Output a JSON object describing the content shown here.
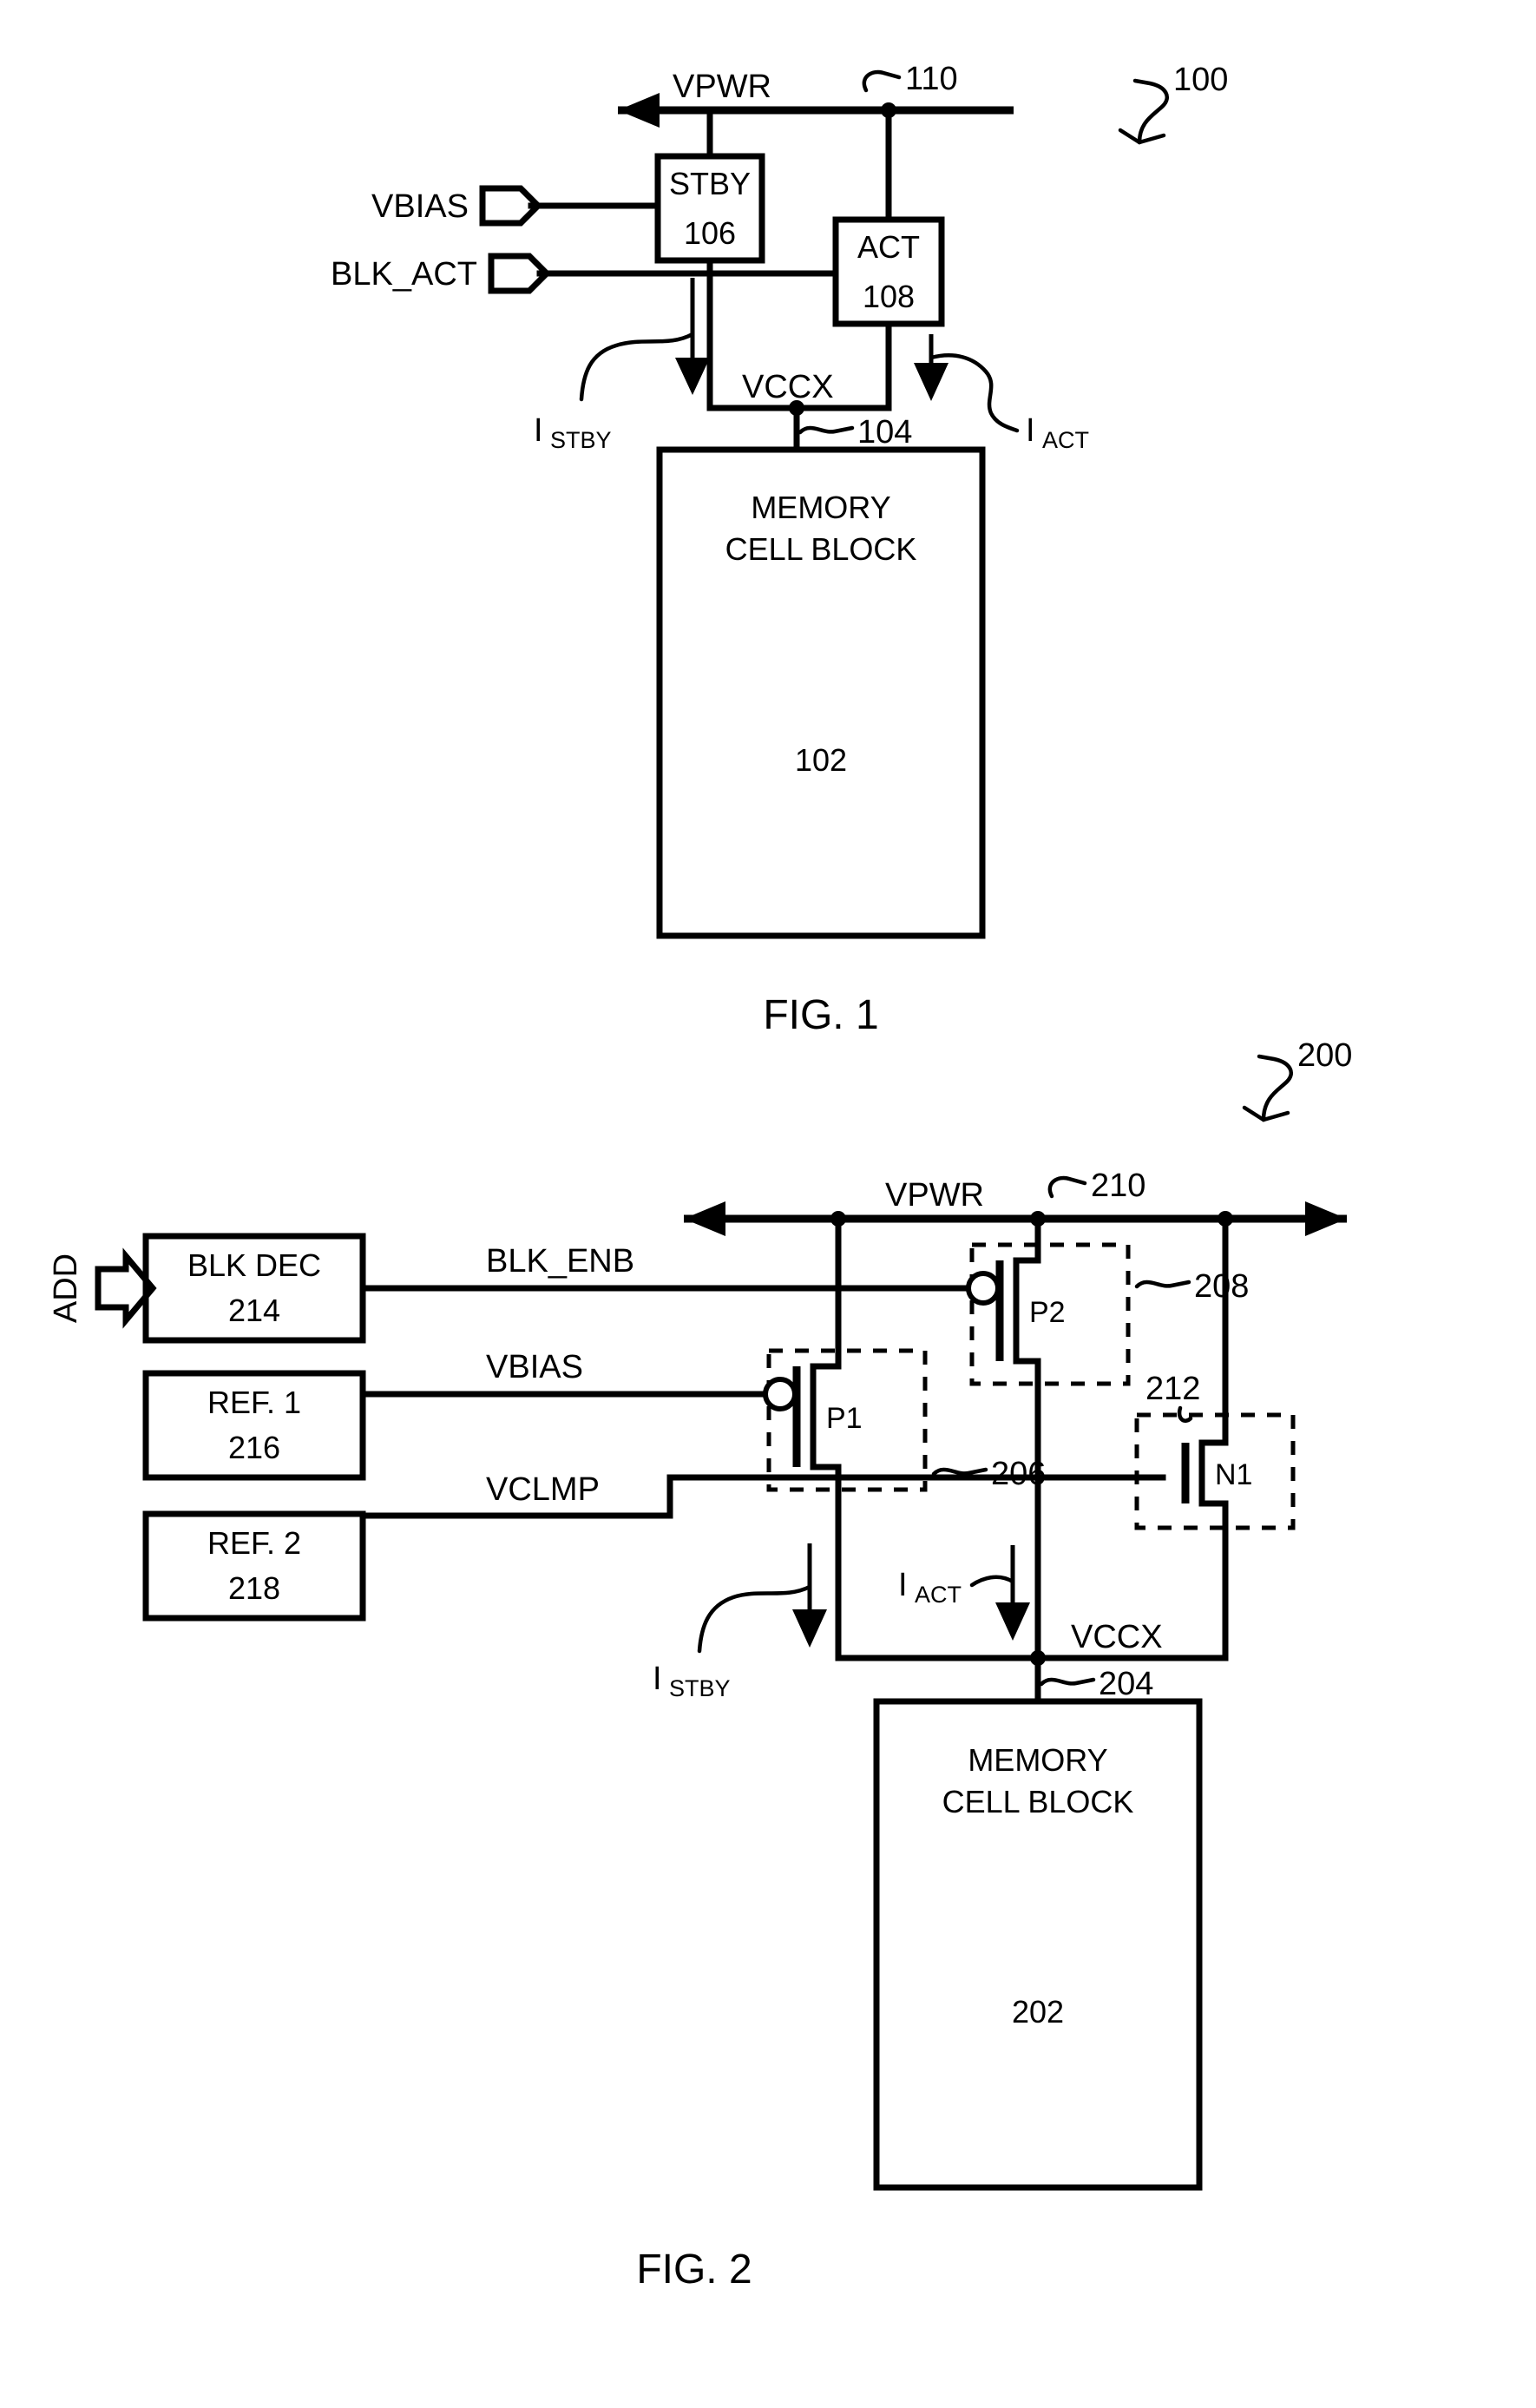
{
  "document": {
    "type": "patent-drawing-sheet",
    "figures": [
      {
        "id": "fig1",
        "caption": "FIG. 1",
        "ref_number": "100",
        "signals": {
          "vpwr": "VPWR",
          "vbias": "VBIAS",
          "blk_act": "BLK_ACT",
          "vccx": "VCCX"
        },
        "nodes": {
          "power_rail": "110",
          "vccx_node": "104"
        },
        "currents": {
          "stby": {
            "symbol": "I",
            "subscript": "STBY"
          },
          "act": {
            "symbol": "I",
            "subscript": "ACT"
          }
        },
        "blocks": [
          {
            "name": "STBY",
            "number": "106"
          },
          {
            "name": "ACT",
            "number": "108"
          },
          {
            "name_line1": "MEMORY",
            "name_line2": "CELL BLOCK",
            "number": "102"
          }
        ]
      },
      {
        "id": "fig2",
        "caption": "FIG. 2",
        "ref_number": "200",
        "signals": {
          "vpwr": "VPWR",
          "add": "ADD",
          "blk_enb": "BLK_ENB",
          "vbias": "VBIAS",
          "vclmp": "VCLMP",
          "vccx": "VCCX"
        },
        "nodes": {
          "power_rail": "210",
          "vccx_node": "204"
        },
        "currents": {
          "stby": {
            "symbol": "I",
            "subscript": "STBY"
          },
          "act": {
            "symbol": "I",
            "subscript": "ACT"
          }
        },
        "blocks": [
          {
            "name": "BLK DEC",
            "number": "214"
          },
          {
            "name": "REF. 1",
            "number": "216"
          },
          {
            "name": "REF. 2",
            "number": "218"
          },
          {
            "name_line1": "MEMORY",
            "name_line2": "CELL BLOCK",
            "number": "202"
          }
        ],
        "transistors": [
          {
            "label": "P1",
            "number": "206",
            "type": "pmos"
          },
          {
            "label": "P2",
            "number": "208",
            "type": "pmos"
          },
          {
            "label": "N1",
            "number": "212",
            "type": "nmos"
          }
        ]
      }
    ],
    "colors": {
      "ink": "#000000",
      "paper": "#ffffff"
    }
  }
}
